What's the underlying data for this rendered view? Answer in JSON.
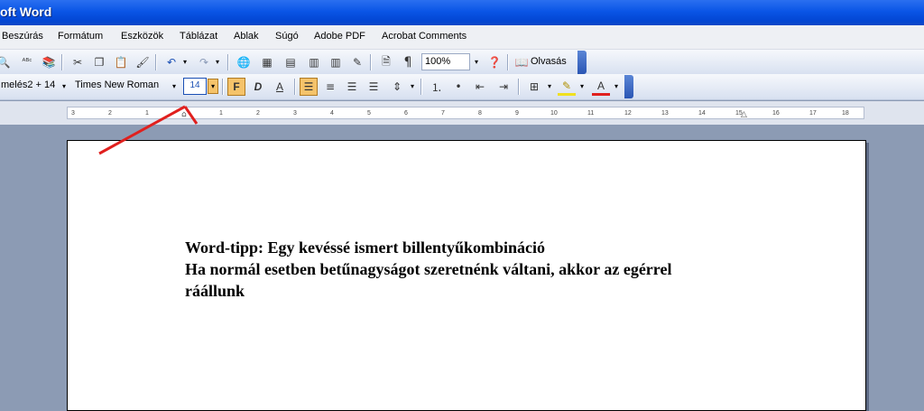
{
  "window": {
    "title": "oft Word"
  },
  "menu": [
    "Beszúrás",
    "Formátum",
    "Eszközök",
    "Táblázat",
    "Ablak",
    "Súgó",
    "Adobe PDF",
    "Acrobat Comments"
  ],
  "toolbar_standard": {
    "zoom": "100%",
    "read_label": "Olvasás"
  },
  "toolbar_format": {
    "style": "melés2 + 14",
    "font": "Times New Roman",
    "size": "14",
    "bold": "F",
    "italic": "D",
    "underline": "A",
    "font_color": "A"
  },
  "ruler": {
    "ticks": [
      "3",
      "2",
      "1",
      "1",
      "2",
      "3",
      "4",
      "5",
      "6",
      "7",
      "8",
      "9",
      "10",
      "11",
      "12",
      "13",
      "14",
      "15",
      "16",
      "17",
      "18"
    ]
  },
  "document": {
    "lines": [
      "Word-tipp: Egy kevéssé ismert billentyűkombináció",
      "Ha normál esetben betűnagyságot szeretnénk váltani, akkor az egérrel",
      "ráállunk"
    ]
  },
  "colors": {
    "annotation_arrow": "#e0201e",
    "highlight": "#f5c36a"
  }
}
